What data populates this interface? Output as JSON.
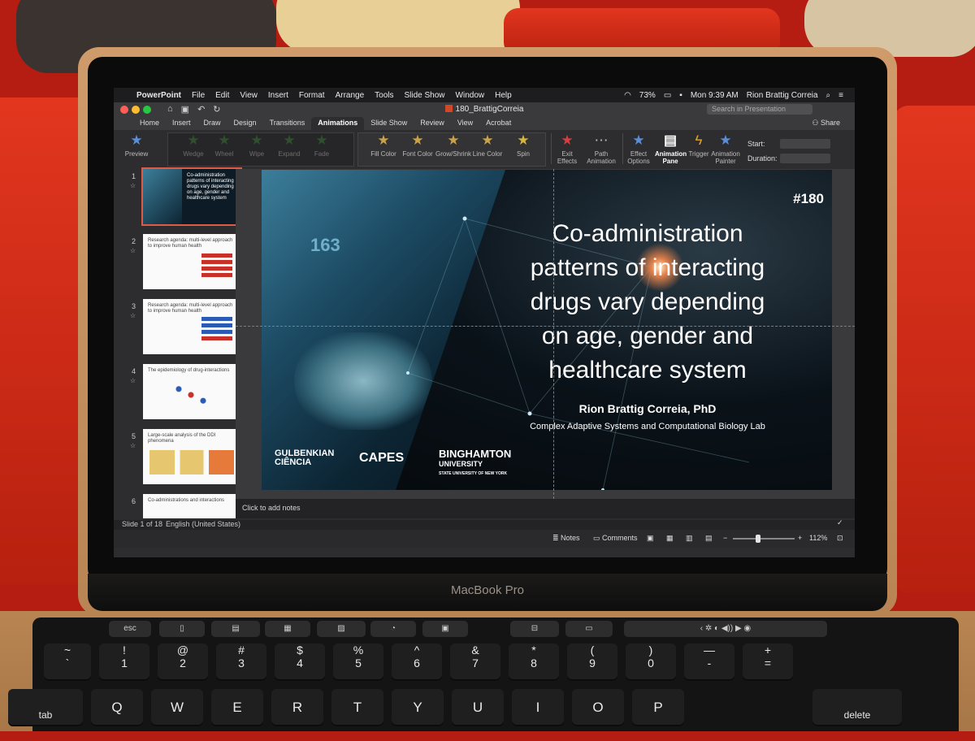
{
  "menubar": {
    "app_name": "PowerPoint",
    "items": [
      "File",
      "Edit",
      "View",
      "Insert",
      "Format",
      "Arrange",
      "Tools",
      "Slide Show",
      "Window",
      "Help"
    ],
    "battery": "73%",
    "clock": "Mon 9:39 AM",
    "user": "Rion Brattig Correia"
  },
  "window": {
    "document_title": "180_BrattigCorreia",
    "search_placeholder": "Search in Presentation"
  },
  "ribbon_tabs": [
    "Home",
    "Insert",
    "Draw",
    "Design",
    "Transitions",
    "Animations",
    "Slide Show",
    "Review",
    "View",
    "Acrobat"
  ],
  "active_tab": "Animations",
  "share_label": "Share",
  "ribbon": {
    "preview": "Preview",
    "entrance": [
      "Wedge",
      "Wheel",
      "Wipe",
      "Expand",
      "Fade"
    ],
    "emphasis": [
      "Fill Color",
      "Font Color",
      "Grow/Shrink",
      "Line Color",
      "Spin"
    ],
    "exit_effects": "Exit Effects",
    "path_animation": "Path Animation",
    "effect_options": "Effect Options",
    "animation_pane": "Animation Pane",
    "trigger": "Trigger",
    "animation_painter": "Animation Painter",
    "start_label": "Start:",
    "duration_label": "Duration:"
  },
  "thumbnails": [
    {
      "num": "1",
      "title": "Co-administration patterns of interacting drugs vary depending on age, gender and healthcare system"
    },
    {
      "num": "2",
      "title": "Research agenda: multi-level approach to improve human health"
    },
    {
      "num": "3",
      "title": "Research agenda: multi-level approach to improve human health"
    },
    {
      "num": "4",
      "title": "The epidemiology of drug-interactions"
    },
    {
      "num": "5",
      "title": "Large-scale analysis of the DDI phenomena"
    },
    {
      "num": "6",
      "title": "Co-administrations and interactions"
    }
  ],
  "slide": {
    "badge": "#180",
    "title_lines": [
      "Co-administration",
      "patterns of interacting",
      "drugs vary depending",
      "on age, gender and",
      "healthcare system"
    ],
    "author": "Rion Brattig Correia, PhD",
    "lab": "Complex Adaptive Systems and Computational Biology Lab",
    "logos": [
      "GULBENKIAN",
      "CIÊNCIA",
      "CAPES",
      "BINGHAMTON",
      "UNIVERSITY",
      "STATE UNIVERSITY OF NEW YORK"
    ],
    "photo_digits": "163"
  },
  "notes_placeholder": "Click to add notes",
  "status": {
    "slide_position": "Slide 1 of 18",
    "language": "English (United States)",
    "notes_button": "Notes",
    "comments_button": "Comments",
    "zoom": "112%"
  },
  "laptop_brand": "MacBook Pro",
  "keyboard": {
    "touchbar": [
      "esc"
    ],
    "number_row": [
      {
        "top": "~",
        "bottom": "`"
      },
      {
        "top": "!",
        "bottom": "1"
      },
      {
        "top": "@",
        "bottom": "2"
      },
      {
        "top": "#",
        "bottom": "3"
      },
      {
        "top": "$",
        "bottom": "4"
      },
      {
        "top": "%",
        "bottom": "5"
      },
      {
        "top": "^",
        "bottom": "6"
      },
      {
        "top": "&",
        "bottom": "7"
      },
      {
        "top": "*",
        "bottom": "8"
      },
      {
        "top": "(",
        "bottom": "9"
      },
      {
        "top": ")",
        "bottom": "0"
      },
      {
        "top": "—",
        "bottom": "-"
      },
      {
        "top": "+",
        "bottom": "="
      }
    ],
    "letter_row": [
      "tab",
      "Q",
      "W",
      "E",
      "R",
      "T",
      "Y",
      "U",
      "I",
      "O",
      "P",
      "delete"
    ]
  },
  "colors": {
    "accent_red": "#d24726",
    "slide_bg": "#05080b",
    "selected_thumb": "#e05b45"
  }
}
